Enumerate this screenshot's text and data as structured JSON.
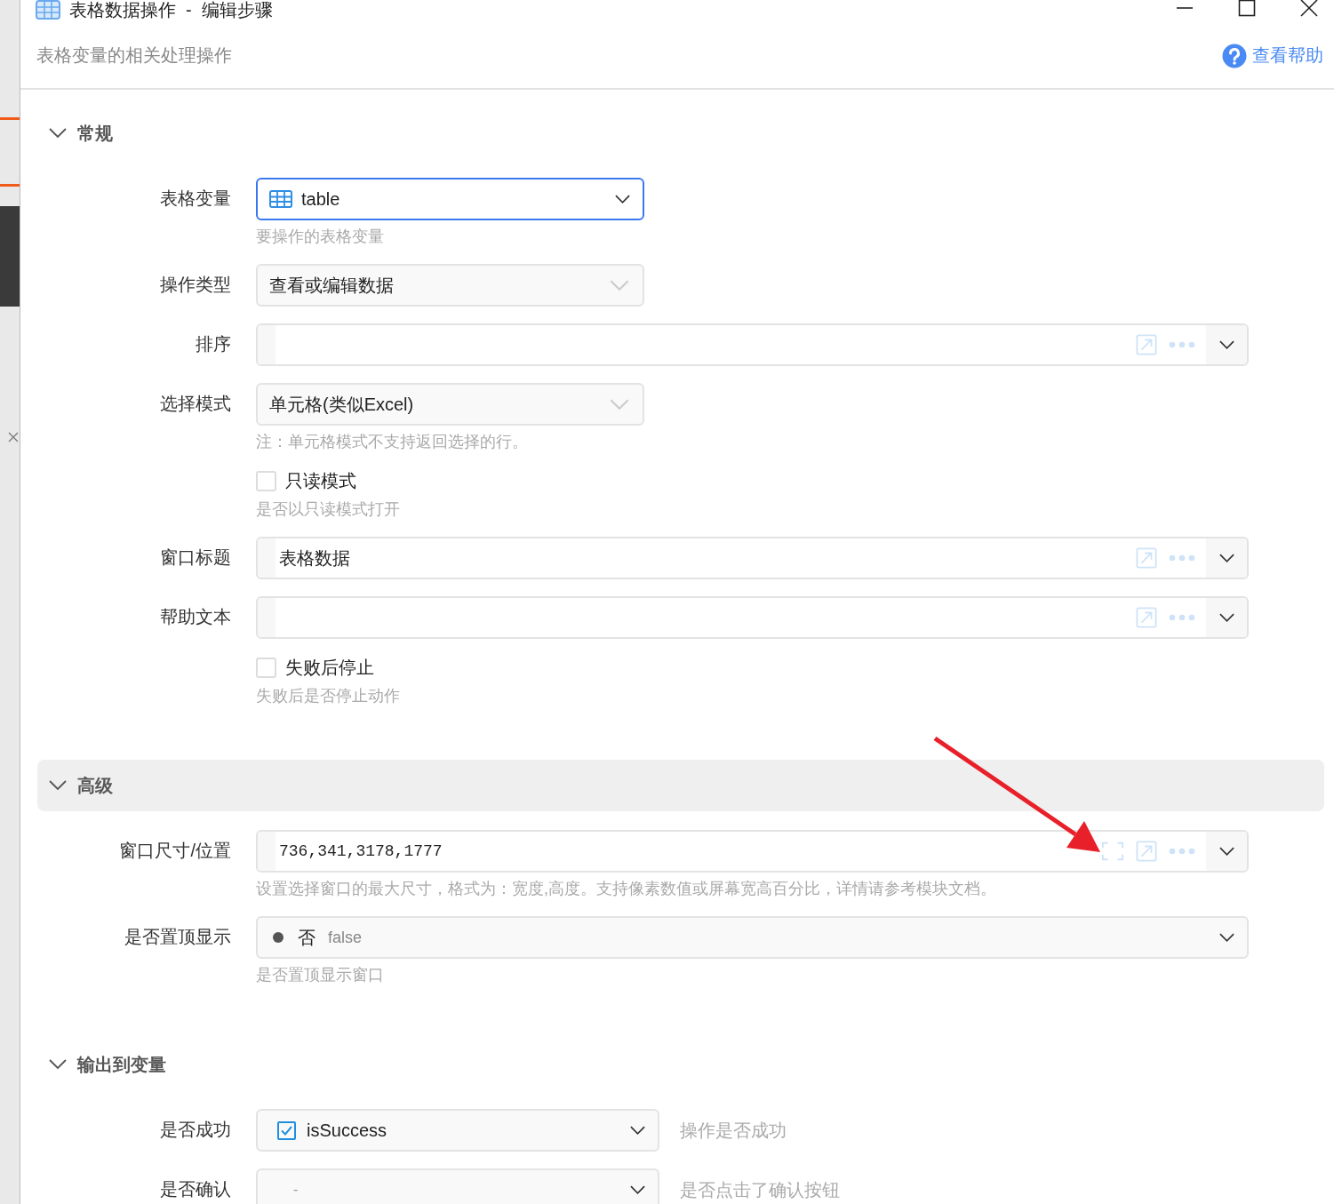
{
  "window": {
    "title": "表格数据操作  -  编辑步骤"
  },
  "header": {
    "subtitle": "表格变量的相关处理操作",
    "help_link": "查看帮助"
  },
  "sections": [
    {
      "title": "常规",
      "expanded": true,
      "highlighted": false,
      "fields": [
        {
          "kind": "table_select",
          "label": "表格变量",
          "value": "table",
          "focused": true,
          "hint": "要操作的表格变量"
        },
        {
          "kind": "select",
          "label": "操作类型",
          "value": "查看或编辑数据",
          "focused": false
        },
        {
          "kind": "expression",
          "label": "排序",
          "fullscreen": false
        },
        {
          "kind": "select",
          "label": "选择模式",
          "value": "单元格(类似Excel)",
          "focused": false,
          "hint": "注：单元格模式不支持返回选择的行。"
        },
        {
          "kind": "checkbox",
          "label": "只读模式",
          "checked": false,
          "hint": "是否以只读模式打开"
        },
        {
          "kind": "expression",
          "label": "窗口标题",
          "value": "表格数据",
          "fullscreen": false
        },
        {
          "kind": "expression",
          "label": "帮助文本",
          "fullscreen": false
        },
        {
          "kind": "checkbox",
          "label": "失败后停止",
          "checked": false,
          "hint": "失败后是否停止动作"
        }
      ]
    },
    {
      "title": "高级",
      "expanded": true,
      "highlighted": true,
      "fields": [
        {
          "kind": "expression",
          "label": "窗口尺寸/位置",
          "value": "736,341,3178,1777",
          "mono": true,
          "fullscreen": true,
          "hint": "设置选择窗口的最大尺寸，格式为：宽度,高度。支持像素数值或屏幕宽高百分比，详情请参考模块文档。"
        },
        {
          "kind": "bool",
          "label": "是否置顶显示",
          "on": false,
          "value": "否",
          "code": "false",
          "hint": "是否置顶显示窗口"
        }
      ]
    },
    {
      "title": "输出到变量",
      "expanded": true,
      "highlighted": false,
      "fields": [
        {
          "kind": "output",
          "label": "是否成功",
          "checked": true,
          "value": "isSuccess",
          "note": "操作是否成功"
        },
        {
          "kind": "output",
          "label": "是否确认",
          "checked": false,
          "value": "-",
          "note": "是否点击了确认按钮"
        }
      ]
    }
  ]
}
